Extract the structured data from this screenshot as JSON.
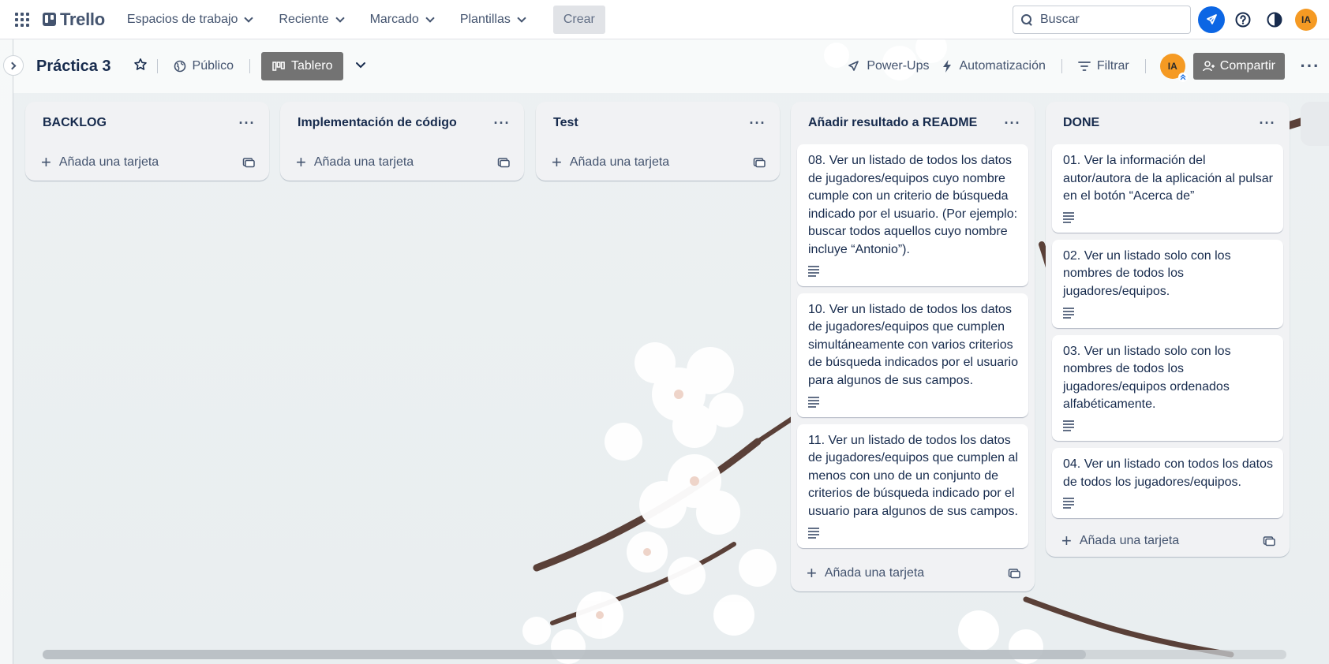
{
  "app": {
    "name": "Trello"
  },
  "topnav": {
    "menu": [
      {
        "label": "Espacios de trabajo"
      },
      {
        "label": "Reciente"
      },
      {
        "label": "Marcado"
      },
      {
        "label": "Plantillas"
      }
    ],
    "create_label": "Crear",
    "search_placeholder": "Buscar",
    "user_initials": "IA"
  },
  "board": {
    "title": "Práctica 3",
    "visibility_label": "Público",
    "view_label": "Tablero",
    "powerups_label": "Power-Ups",
    "automation_label": "Automatización",
    "filter_label": "Filtrar",
    "share_label": "Compartir",
    "member_initials": "IA"
  },
  "lists": [
    {
      "title": "BACKLOG",
      "cards": [],
      "add_label": "Añada una tarjeta"
    },
    {
      "title": "Implementación de código",
      "cards": [],
      "add_label": "Añada una tarjeta"
    },
    {
      "title": "Test",
      "cards": [],
      "add_label": "Añada una tarjeta"
    },
    {
      "title": "Añadir resultado a README",
      "cards": [
        {
          "text": "08. Ver un listado de todos los datos de jugadores/equipos cuyo nombre cumple con un criterio de búsqueda indicado por el usuario. (Por ejemplo: buscar todos aquellos cuyo nombre incluye “Antonio”).",
          "has_description": true
        },
        {
          "text": "10. Ver un listado de todos los datos de jugadores/equipos que cumplen simultáneamente con varios criterios de búsqueda indicados por el usuario para algunos de sus campos.",
          "has_description": true
        },
        {
          "text": "11. Ver un listado de todos los datos de jugadores/equipos que cumplen al menos con uno de un conjunto de criterios de búsqueda indicado por el usuario para algunos de sus campos.",
          "has_description": true
        }
      ],
      "add_label": "Añada una tarjeta"
    },
    {
      "title": "DONE",
      "cards": [
        {
          "text": "01. Ver la información del autor/autora de la aplicación al pulsar en el botón “Acerca de”",
          "has_description": true
        },
        {
          "text": "02. Ver un listado solo con los nombres de todos los jugadores/equipos.",
          "has_description": true
        },
        {
          "text": "03. Ver un listado solo con los nombres de todos los jugadores/equipos ordenados alfabéticamente.",
          "has_description": true
        },
        {
          "text": "04. Ver un listado con todos los datos de todos los jugadores/equipos.",
          "has_description": true
        }
      ],
      "add_label": "Añada una tarjeta"
    }
  ],
  "icons": {
    "apps": "grid-icon",
    "search": "search-icon",
    "notifications": "rocket-icon",
    "help": "help-icon",
    "theme": "contrast-icon",
    "star": "star-icon",
    "visibility": "globe-icon",
    "view": "board-icon",
    "powerups": "rocket-icon",
    "automation": "lightning-icon",
    "filter": "filter-icon",
    "share": "add-person-icon",
    "card_description": "description-icon",
    "card_template": "template-icon"
  },
  "colors": {
    "nav_background": "#ffffff",
    "accent_blue": "#0c66e4",
    "avatar_orange": "#f59a23",
    "view_button": "#737373",
    "list_background": "#f1f2f4"
  }
}
